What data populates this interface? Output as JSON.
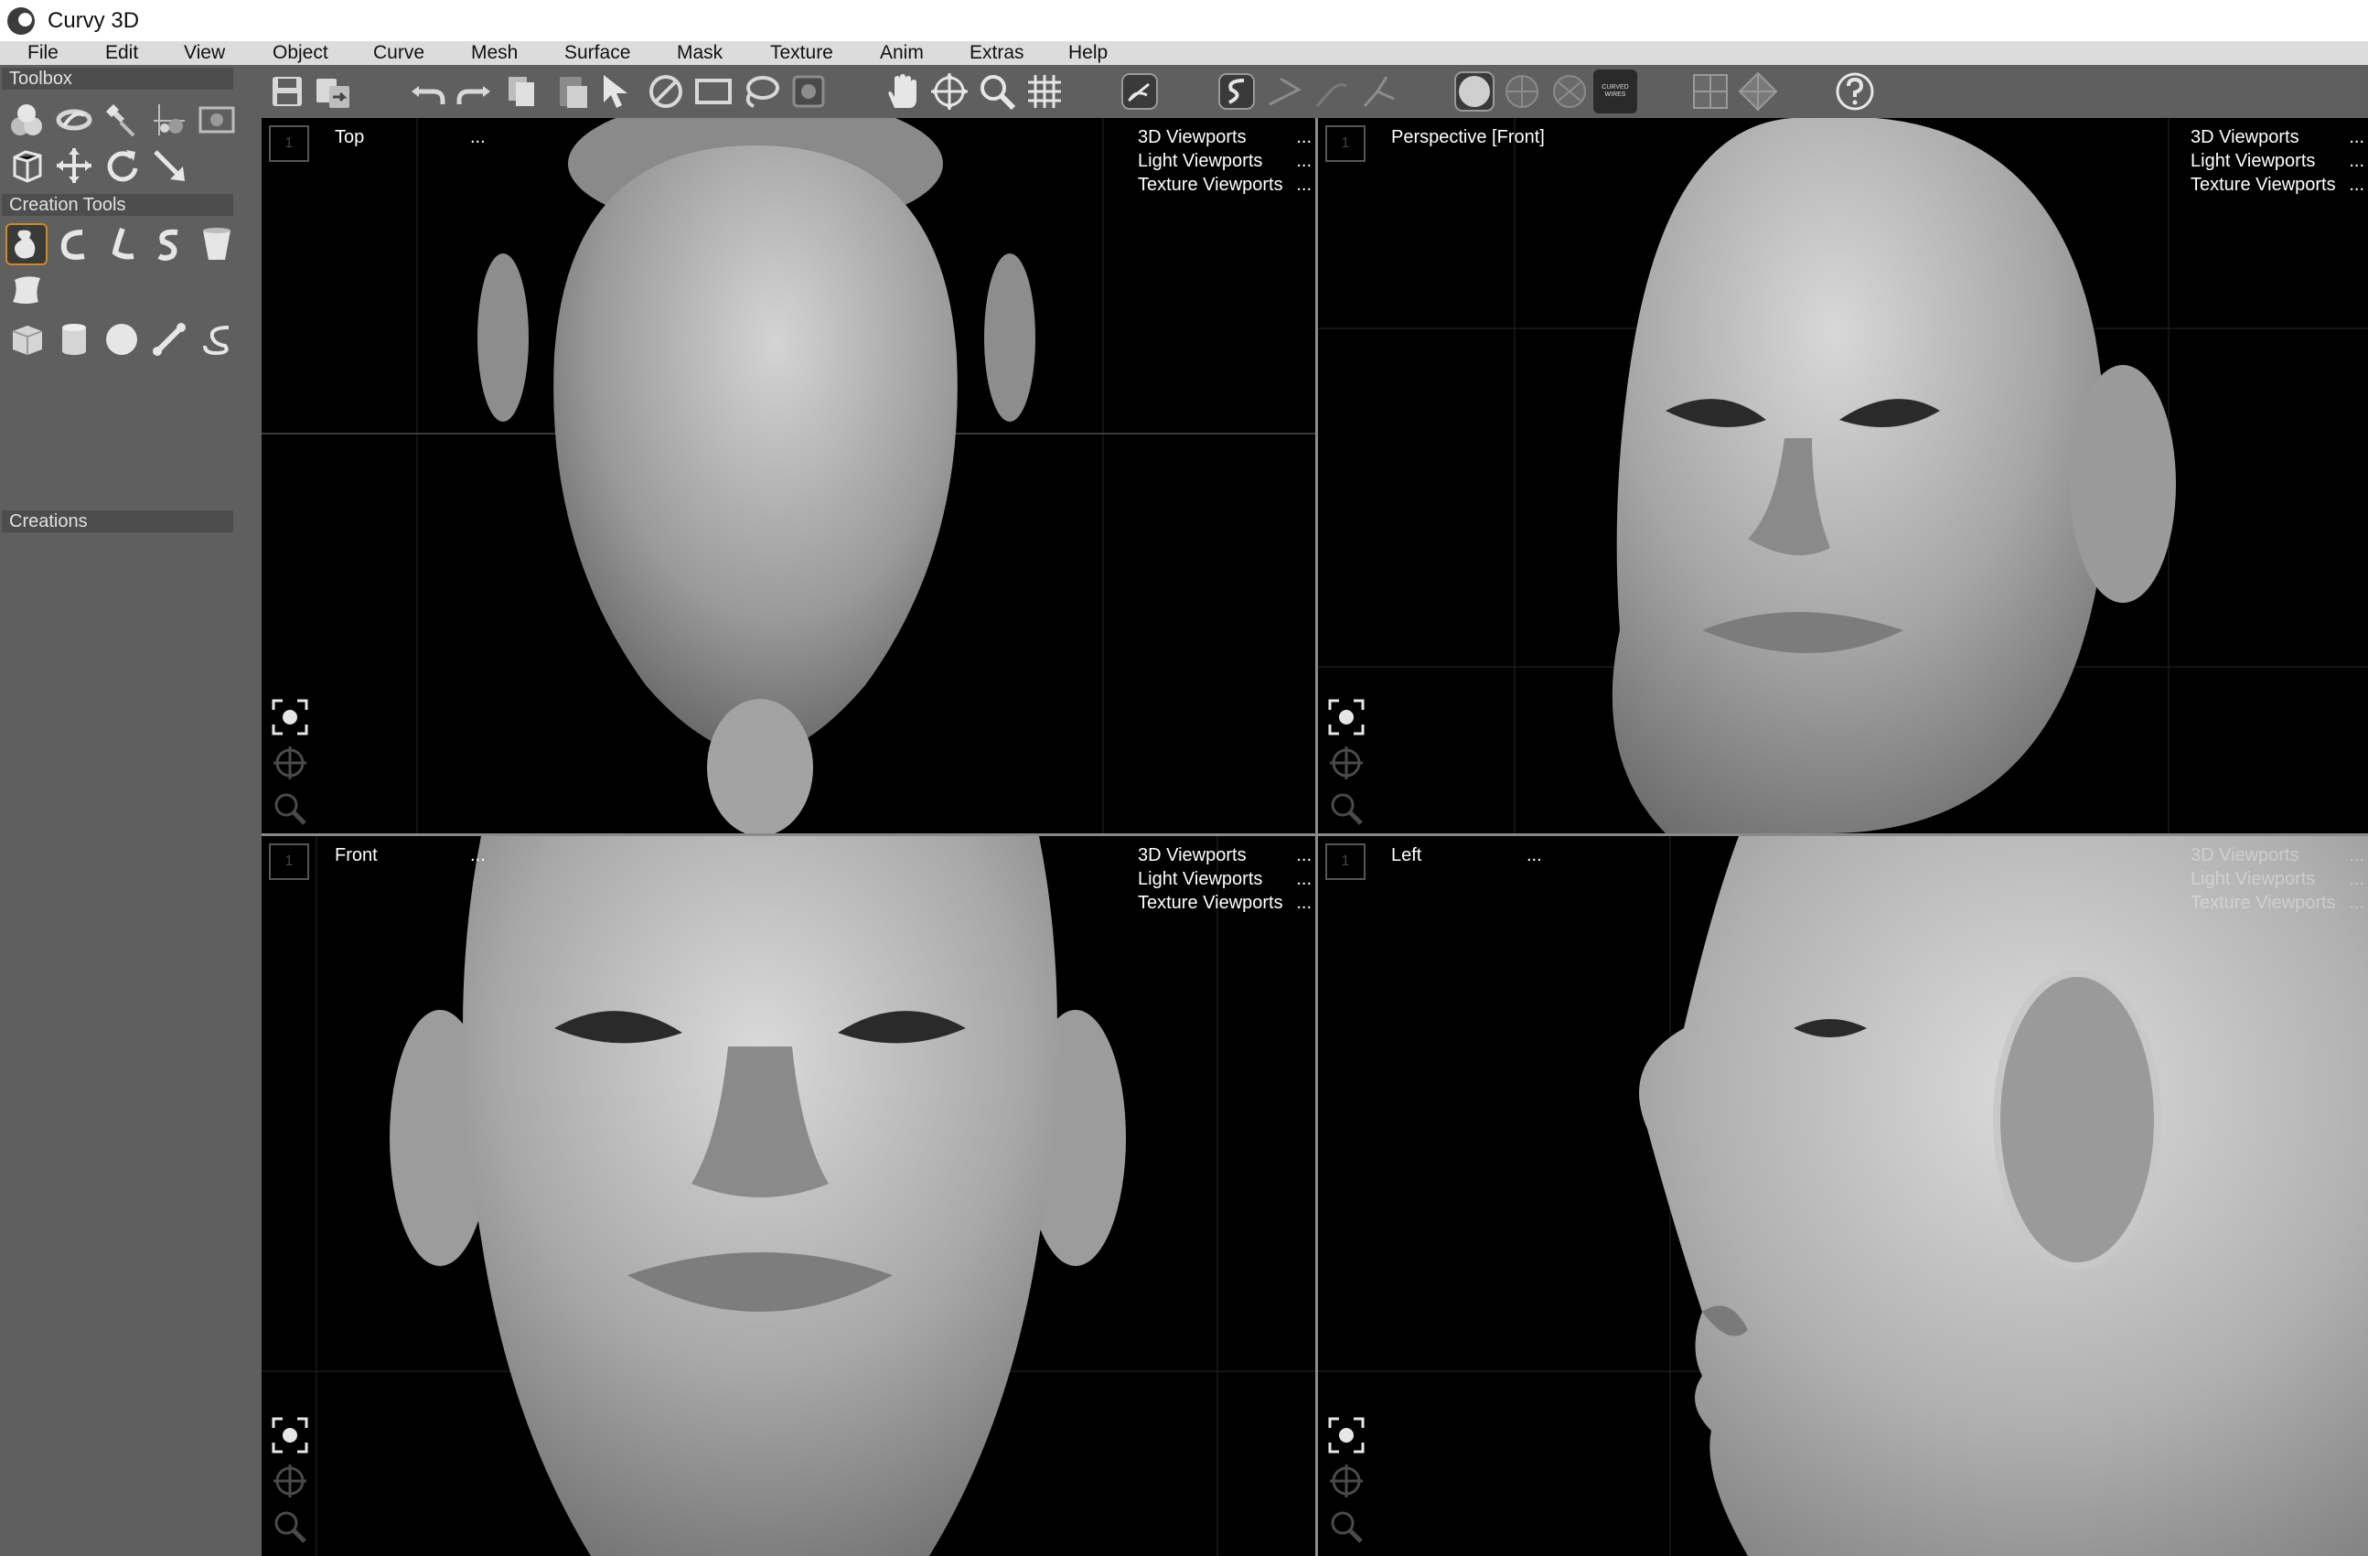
{
  "window": {
    "title": "Curvy 3D"
  },
  "menu": [
    "File",
    "Edit",
    "View",
    "Object",
    "Curve",
    "Mesh",
    "Surface",
    "Mask",
    "Texture",
    "Anim",
    "Extras",
    "Help"
  ],
  "panels": {
    "toolbox": "Toolbox",
    "creation_tools": "Creation Tools",
    "creations": "Creations"
  },
  "toolbar_badge": "CURVED\nWIRES",
  "viewports": [
    {
      "label": "Top",
      "dots": "...",
      "menu": [
        "3D Viewports",
        "Light Viewports",
        "Texture Viewports"
      ],
      "num": "1"
    },
    {
      "label": "Perspective [Front]",
      "dots": "",
      "menu": [
        "3D Viewports",
        "Light Viewports",
        "Texture Viewports"
      ],
      "num": "1"
    },
    {
      "label": "Front",
      "dots": "...",
      "menu": [
        "3D Viewports",
        "Light Viewports",
        "Texture Viewports"
      ],
      "num": "1"
    },
    {
      "label": "Left",
      "dots": "...",
      "menu": [
        "3D Viewports",
        "Light Viewports",
        "Texture Viewports"
      ],
      "num": "1"
    }
  ],
  "menu_dots": "...",
  "colors": {
    "panel": "#5f5f5f",
    "header": "#4d4d4d",
    "viewport": "#000000",
    "selected_tool_border": "#c98a2a"
  }
}
